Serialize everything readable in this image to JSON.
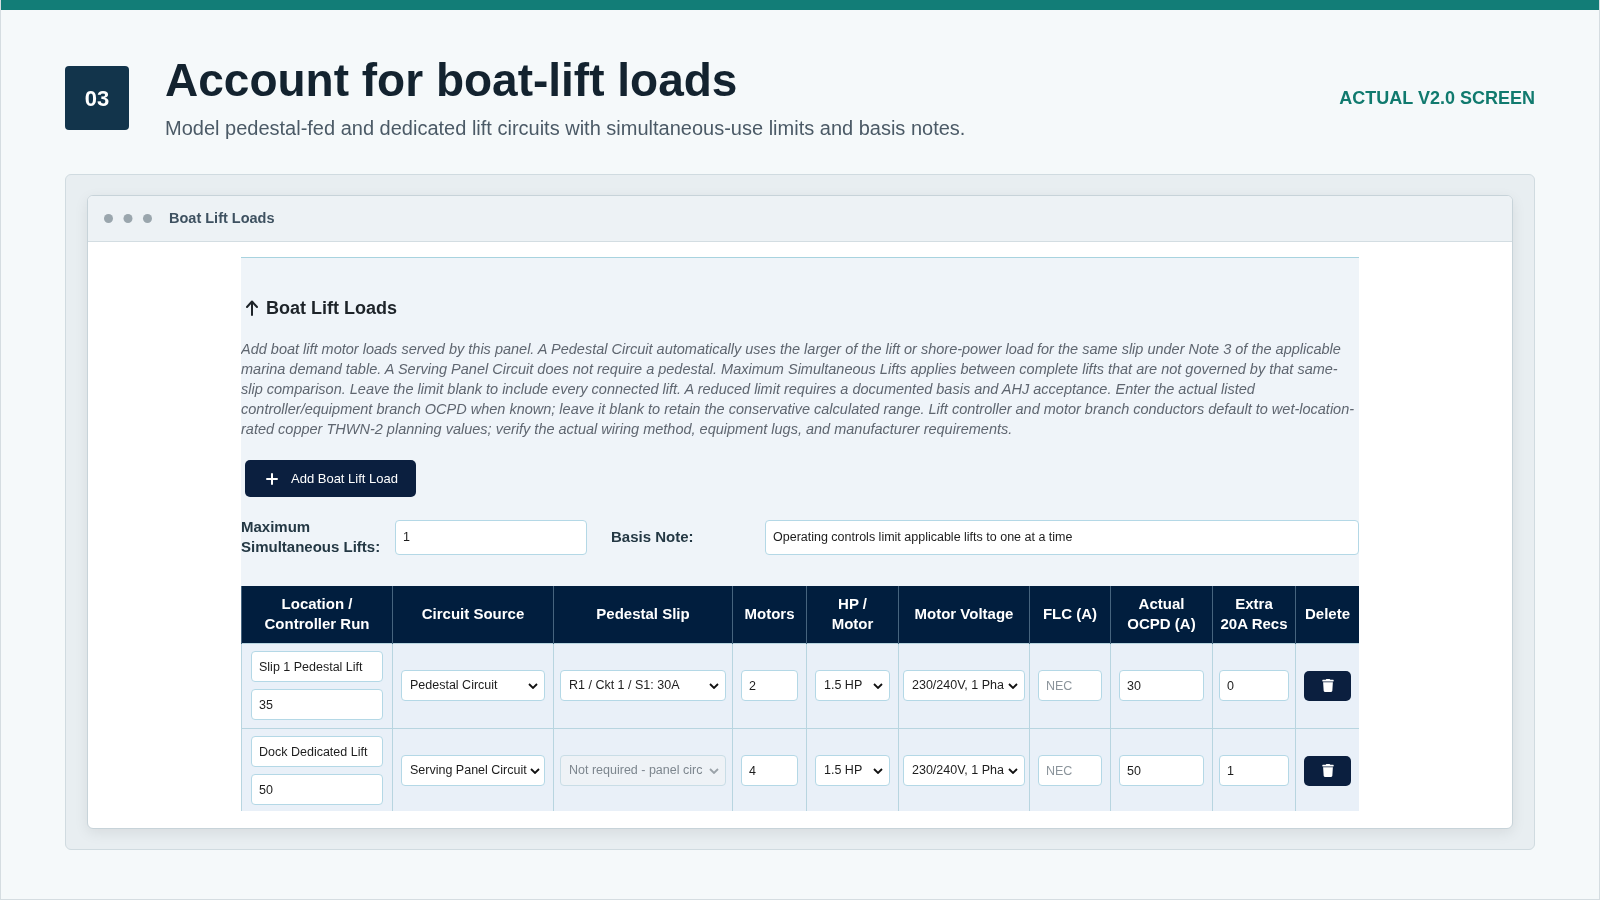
{
  "header": {
    "step": "03",
    "title": "Account for boat-lift loads",
    "subtitle": "Model pedestal-fed and dedicated lift circuits with simultaneous-use limits and basis notes.",
    "tag": "ACTUAL V2.0 SCREEN"
  },
  "window": {
    "title": "Boat Lift Loads"
  },
  "section": {
    "heading": "Boat Lift Loads",
    "description": "Add boat lift motor loads served by this panel. A Pedestal Circuit automatically uses the larger of the lift or shore-power load for the same slip under Note 3 of the applicable marina demand table. A Serving Panel Circuit does not require a pedestal. Maximum Simultaneous Lifts applies between complete lifts that are not governed by that same-slip comparison. Leave the limit blank to include every connected lift. A reduced limit requires a documented basis and AHJ acceptance. Enter the actual listed controller/equipment branch OCPD when known; leave it blank to retain the conservative calculated range. Lift controller and motor branch conductors default to wet-location-rated copper THWN-2 planning values; verify the actual wiring method, equipment lugs, and manufacturer requirements.",
    "add_button": "Add Boat Lift Load",
    "max_lifts": {
      "label": "Maximum Simultaneous Lifts:",
      "value": "1"
    },
    "basis_note": {
      "label": "Basis Note:",
      "value": "Operating controls limit applicable lifts to one at a time"
    }
  },
  "table": {
    "columns": [
      "Location / Controller Run",
      "Circuit Source",
      "Pedestal Slip",
      "Motors",
      "HP / Motor",
      "Motor Voltage",
      "FLC (A)",
      "Actual OCPD (A)",
      "Extra 20A Recs",
      "Delete"
    ],
    "rows": [
      {
        "cells": [
          {
            "kind": "input_stack",
            "values": [
              "Slip 1 Pedestal Lift",
              "35"
            ]
          },
          {
            "kind": "dropdown",
            "value": "Pedestal Circuit",
            "disabled": false
          },
          {
            "kind": "dropdown",
            "value": "R1 / Ckt 1 / S1: 30A",
            "disabled": false
          },
          {
            "kind": "input",
            "value": "2"
          },
          {
            "kind": "dropdown",
            "value": "1.5 HP",
            "disabled": false
          },
          {
            "kind": "dropdown",
            "value": "230/240V, 1 Pha",
            "disabled": false
          },
          {
            "kind": "input",
            "placeholder": "NEC"
          },
          {
            "kind": "input",
            "value": "30"
          },
          {
            "kind": "input",
            "value": "0"
          },
          {
            "kind": "delete_button"
          }
        ]
      },
      {
        "cells": [
          {
            "kind": "input_stack",
            "values": [
              "Dock Dedicated Lift",
              "50"
            ]
          },
          {
            "kind": "dropdown",
            "value": "Serving Panel Circuit",
            "disabled": false
          },
          {
            "kind": "dropdown",
            "value": "Not required - panel circ",
            "disabled": true
          },
          {
            "kind": "input",
            "value": "4"
          },
          {
            "kind": "dropdown",
            "value": "1.5 HP",
            "disabled": false
          },
          {
            "kind": "dropdown",
            "value": "230/240V, 1 Pha",
            "disabled": false
          },
          {
            "kind": "input",
            "placeholder": "NEC"
          },
          {
            "kind": "input",
            "value": "50"
          },
          {
            "kind": "input",
            "value": "1"
          },
          {
            "kind": "delete_button"
          }
        ]
      }
    ]
  }
}
